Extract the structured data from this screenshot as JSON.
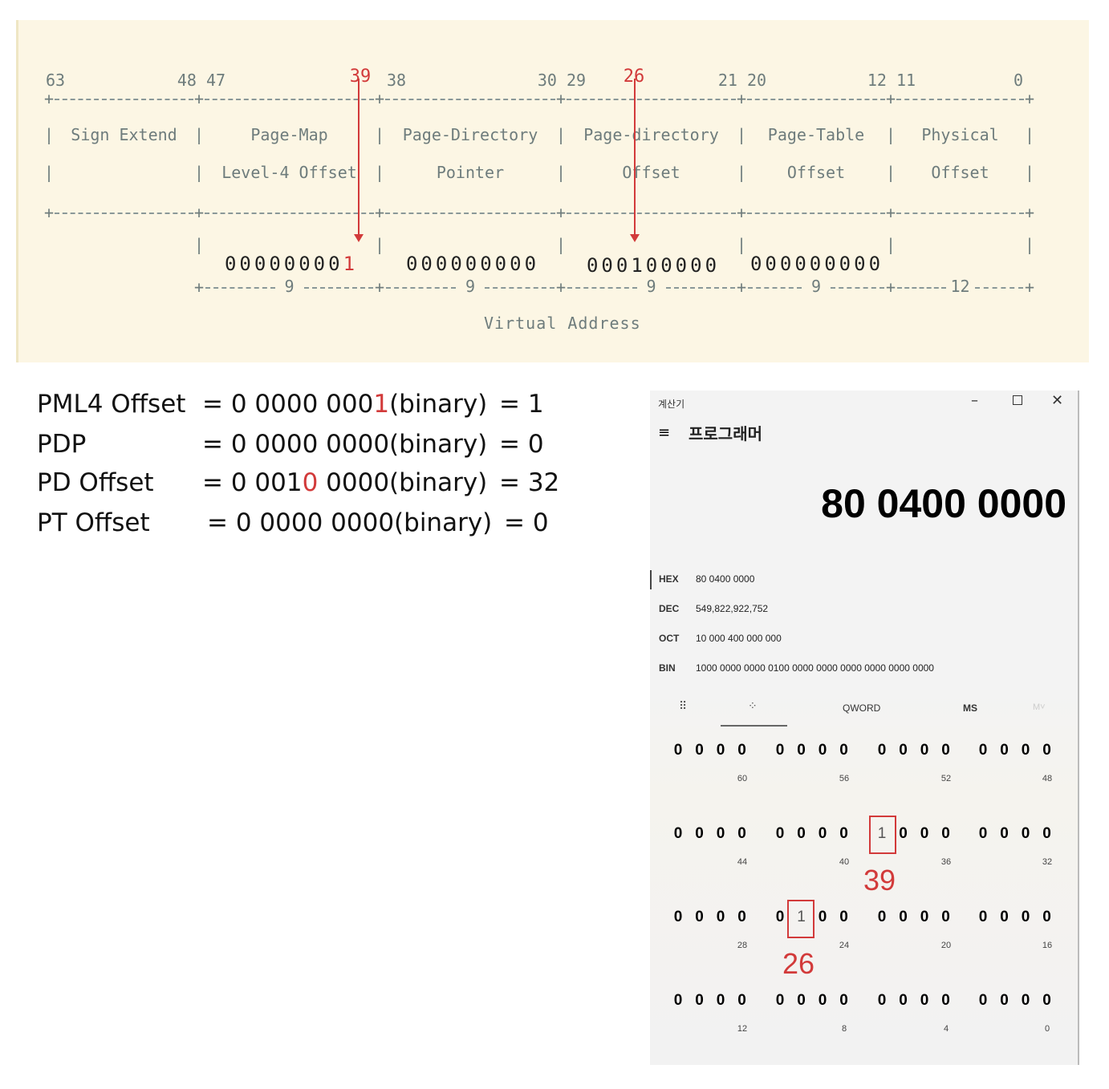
{
  "diagram": {
    "bit_numbers": [
      "63",
      "48 47",
      "39",
      "38",
      "30 29",
      "26",
      "21 20",
      "12 11",
      "0"
    ],
    "row1": [
      "Sign Extend",
      "Page-Map",
      "Page-Directory",
      "Page-directory",
      "Page-Table",
      "Physical"
    ],
    "row2": [
      "",
      "Level-4 Offset",
      "Pointer",
      "Offset",
      "Offset",
      "Offset"
    ],
    "values": [
      "00000000",
      "1",
      "000000000",
      "000100000",
      "000000000"
    ],
    "widths": [
      "9",
      "9",
      "9",
      "9",
      "12"
    ],
    "caption": "Virtual Address",
    "highlight_color": "#d23a3a"
  },
  "equations": [
    {
      "name": "PML4 Offset",
      "pre": "= 0 0000 000",
      "red": "1",
      "post": "(binary)",
      "result": "= 1"
    },
    {
      "name": "PDP",
      "pre": "= 0 0000 0000",
      "red": "",
      "post": "(binary)",
      "result": "= 0"
    },
    {
      "name": "PD Offset",
      "pre": "= 0 001",
      "red": "0",
      "post": " 0000(binary)",
      "result": "= 32"
    },
    {
      "name": "PT Offset",
      "pre": "= 0 0000 0000",
      "red": "",
      "post": "(binary)",
      "result": "= 0"
    }
  ],
  "calculator": {
    "app_title": "계산기",
    "mode": "프로그래머",
    "display": "80 0400 0000",
    "radix": [
      {
        "label": "HEX",
        "value": "80 0400 0000"
      },
      {
        "label": "DEC",
        "value": "549,822,922,752"
      },
      {
        "label": "OCT",
        "value": "10 000 400 000 000"
      },
      {
        "label": "BIN",
        "value": "1000 0000 0000 0100 0000 0000 0000 0000 0000 0000"
      }
    ],
    "toolbar": {
      "word_size": "QWORD",
      "ms": "MS",
      "mplus": "M˅"
    },
    "bit_rows": [
      {
        "groups": [
          "0000",
          "0000",
          "0000",
          "0000"
        ],
        "labels": [
          "60",
          "56",
          "52",
          "48"
        ]
      },
      {
        "groups": [
          "0000",
          "0000",
          "1000",
          "0000"
        ],
        "labels": [
          "44",
          "40",
          "36",
          "32"
        ]
      },
      {
        "groups": [
          "0000",
          "0100",
          "0000",
          "0000"
        ],
        "labels": [
          "28",
          "24",
          "20",
          "16"
        ]
      },
      {
        "groups": [
          "0000",
          "0000",
          "0000",
          "0000"
        ],
        "labels": [
          "12",
          "8",
          "4",
          "0"
        ]
      }
    ],
    "annotations": [
      "39",
      "26"
    ]
  }
}
